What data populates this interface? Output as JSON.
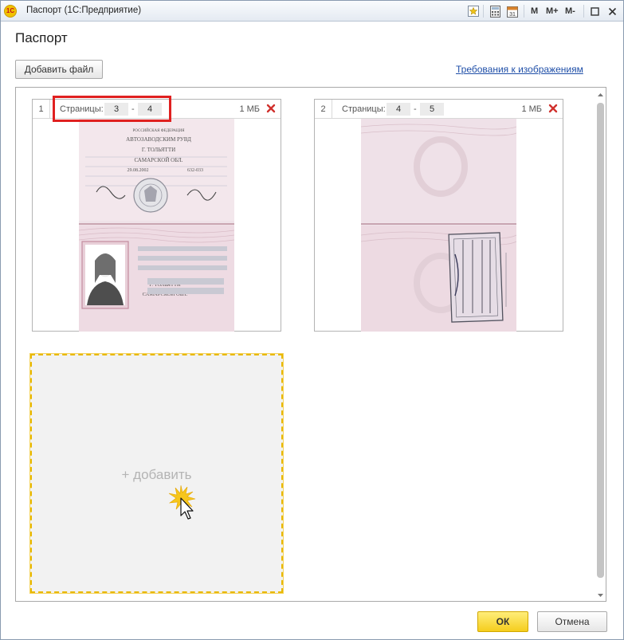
{
  "window": {
    "title": "Паспорт  (1С:Предприятие)",
    "logo_text": "1С",
    "toolbar": {
      "m_label": "M",
      "m_plus_label": "M+",
      "m_minus_label": "M-"
    }
  },
  "header": {
    "title": "Паспорт",
    "add_file_label": "Добавить файл",
    "requirements_link": "Требования к изображениям"
  },
  "files": [
    {
      "index": "1",
      "pages_label": "Страницы:",
      "page_from": "3",
      "page_to": "4",
      "dash": "-",
      "size": "1 МБ"
    },
    {
      "index": "2",
      "pages_label": "Страницы:",
      "page_from": "4",
      "page_to": "5",
      "dash": "-",
      "size": "1 МБ"
    }
  ],
  "scan1": {
    "line1": "РОССИЙСКАЯ ФЕДЕРАЦИЯ",
    "line2": "АВТОЗАВОДСКИМ РУВД",
    "line3": "Г. ТОЛЬЯТТИ",
    "line4": "САМАРСКОЙ ОБЛ.",
    "date": "29.08.2002",
    "code": "632-033",
    "city": "Г. ТОЛЬЯТТИ",
    "region": "САМАРСКОЙ ОБЛ."
  },
  "add_tile": {
    "label": "+ добавить"
  },
  "footer": {
    "ok_label": "ОК",
    "cancel_label": "Отмена"
  },
  "colors": {
    "accent": "#f5cd1d",
    "link": "#1f4fa8",
    "highlight": "#e02020",
    "delete": "#d0312d"
  }
}
